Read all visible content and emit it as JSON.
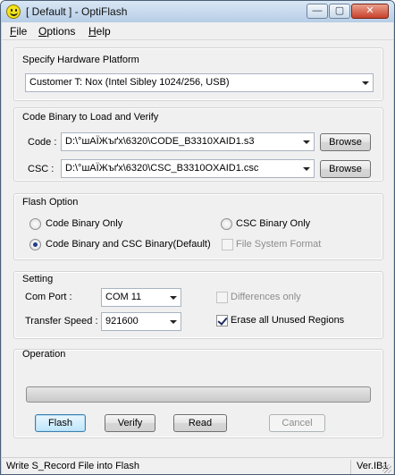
{
  "window": {
    "title": "[ Default ] - OptiFlash",
    "icon": "smiley-icon"
  },
  "title_buttons": {
    "minimize": "—",
    "maximize": "▢",
    "close": "✕"
  },
  "menu": {
    "file": {
      "key": "F",
      "rest": "ile"
    },
    "options": {
      "key": "O",
      "rest": "ptions"
    },
    "help": {
      "key": "H",
      "rest": "elp"
    }
  },
  "hardware": {
    "title": "Specify Hardware Platform",
    "platform": "Customer T: Nox (Intel Sibley 1024/256, USB)"
  },
  "code_binary": {
    "title": "Code Binary to Load and Verify",
    "code_label": "Code :",
    "code_path": "D:\\°шАЇЖъґх\\6320\\CODE_B3310XAID1.s3",
    "csc_label": "CSC :",
    "csc_path": "D:\\°шАЇЖъґх\\6320\\CSC_B3310OXAID1.csc",
    "browse_label": "Browse"
  },
  "flash_option": {
    "title": "Flash Option",
    "code_only": "Code Binary Only",
    "csc_only": "CSC Binary Only",
    "code_and_csc": "Code Binary and CSC Binary(Default)",
    "file_system_format": "File System Format"
  },
  "setting": {
    "title": "Setting",
    "com_port_label": "Com Port :",
    "com_port_value": "COM 11",
    "transfer_speed_label": "Transfer Speed :",
    "transfer_speed_value": "921600",
    "differences_only": "Differences only",
    "erase_unused": "Erase all Unused Regions"
  },
  "operation": {
    "title": "Operation",
    "progress": 0,
    "flash": "Flash",
    "verify": "Verify",
    "read": "Read",
    "cancel": "Cancel"
  },
  "status": {
    "message": "Write S_Record File into Flash",
    "version": "Ver.IB1"
  }
}
